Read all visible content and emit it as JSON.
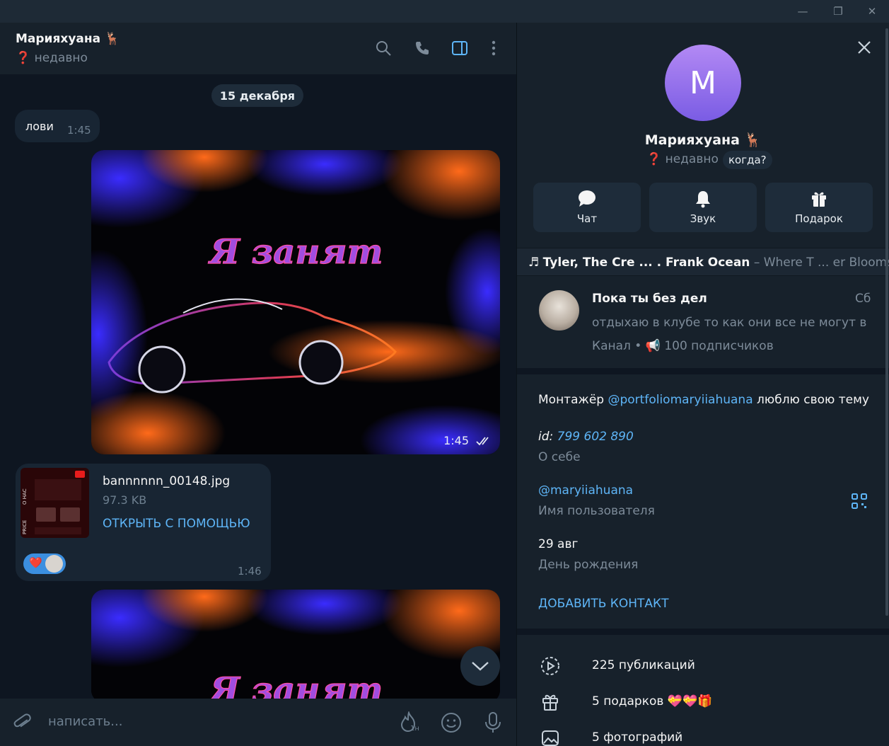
{
  "window": {
    "minimize": "—",
    "restore": "❐",
    "close": "✕"
  },
  "chat": {
    "title": "Марияхуана",
    "title_emoji": "🦌",
    "status_mark": "❓",
    "status": "недавно",
    "date_pill": "15 декабря",
    "messages": [
      {
        "text": "лови",
        "time": "1:45"
      }
    ],
    "media1": {
      "caption_art": "Я занят",
      "time": "1:45"
    },
    "file": {
      "name": "bannnnnn_00148.jpg",
      "size": "97.3 KB",
      "open_label": "ОТКРЫТЬ С ПОМОЩЬЮ",
      "thumb_text_1": "О НАС",
      "thumb_text_2": "PRICE",
      "reaction": "❤️",
      "time": "1:46"
    },
    "media2": {
      "caption_art": "Я занят"
    },
    "composer": {
      "placeholder": "написать...",
      "timer_label": "1н"
    }
  },
  "profile": {
    "avatar_letter": "M",
    "name": "Марияхуана",
    "name_emoji": "🦌",
    "status_mark": "❓",
    "status": "недавно",
    "when_label": "когда?",
    "actions": [
      {
        "label": "Чат",
        "icon": "chat-bubble-icon"
      },
      {
        "label": "Звук",
        "icon": "bell-icon"
      },
      {
        "label": "Подарок",
        "icon": "gift-icon"
      }
    ],
    "music": {
      "note": "♬",
      "artist": "Tyler, The Cre ... . Frank Ocean",
      "dash": "–",
      "track": "Where T ... er Blooms",
      "chevron": "›"
    },
    "channel": {
      "title": "Пока ты без дел",
      "day": "Сб",
      "preview": "отдыхаю в клубе то как они все не могут в...",
      "meta_prefix": "Канал •",
      "meta_emoji": "📢",
      "meta_subscribers": "100 подписчиков"
    },
    "bio_prefix": "Монтажёр ",
    "bio_link": "@portfoliomaryiiahuana",
    "bio_suffix": " люблю свою тему",
    "id_label": "id:",
    "id_value": "799 602 890",
    "bio_caption": "О себе",
    "username": "@maryiiahuana",
    "username_caption": "Имя пользователя",
    "birthday": "29 авг",
    "birthday_caption": "День рождения",
    "add_contact": "ДОБАВИТЬ КОНТАКТ",
    "stats": [
      {
        "text": "225 публикаций",
        "icon": "stories-icon"
      },
      {
        "text": "5 подарков",
        "suffix": "💝💝🎁",
        "icon": "gift-icon"
      },
      {
        "text": "5 фотографий",
        "icon": "photo-icon"
      }
    ]
  }
}
